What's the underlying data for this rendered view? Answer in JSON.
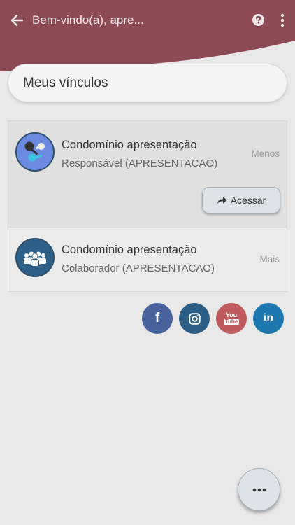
{
  "colors": {
    "header": "#8c4a55",
    "facebook": "#48639c",
    "instagram": "#2c5d85",
    "youtube": "#bf5a5f",
    "linkedin": "#1d78b0"
  },
  "header": {
    "back_icon": "arrow-left-icon",
    "title": "Bem-vindo(a), apre...",
    "help_icon": "question-circle-icon",
    "menu_icon": "vertical-dots-icon"
  },
  "section": {
    "title": "Meus vínculos"
  },
  "items": [
    {
      "icon": "keys-icon",
      "title": "Condomínio apresentação",
      "subtitle": "Responsável (APRESENTACAO)",
      "toggle": "Menos",
      "action_label": "Acessar",
      "action_icon": "share-arrow-icon"
    },
    {
      "icon": "people-group-icon",
      "title": "Condomínio apresentação",
      "subtitle": "Colaborador (APRESENTACAO)",
      "toggle": "Mais"
    }
  ],
  "social": {
    "facebook": {
      "icon": "facebook-icon",
      "label": "f"
    },
    "instagram": {
      "icon": "instagram-icon"
    },
    "youtube": {
      "icon": "youtube-icon",
      "label_top": "You",
      "label_bottom": "Tube"
    },
    "linkedin": {
      "icon": "linkedin-icon",
      "label": "in"
    }
  },
  "fab": {
    "icon": "horizontal-dots-icon"
  }
}
